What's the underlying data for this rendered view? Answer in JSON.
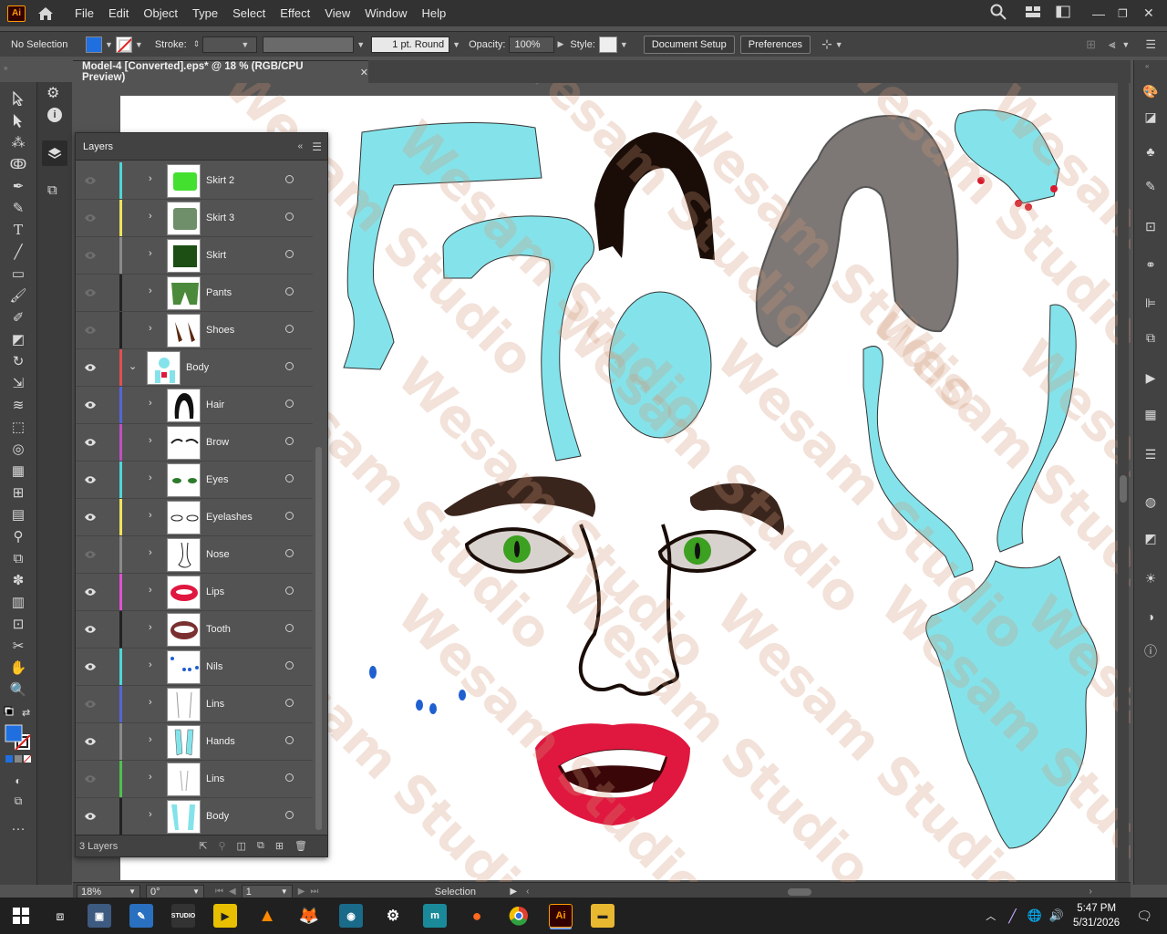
{
  "app": {
    "logo": "Ai"
  },
  "menu": [
    "File",
    "Edit",
    "Object",
    "Type",
    "Select",
    "Effect",
    "View",
    "Window",
    "Help"
  ],
  "control": {
    "selection": "No Selection",
    "stroke_label": "Stroke:",
    "brush_value": "1 pt. Round",
    "opacity_label": "Opacity:",
    "opacity_value": "100%",
    "style_label": "Style:",
    "doc_setup": "Document Setup",
    "preferences": "Preferences",
    "fill_color": "#1f6fe0"
  },
  "document": {
    "tab_title": "Model-4 [Converted].eps* @ 18 % (RGB/CPU Preview)"
  },
  "layers": {
    "title": "Layers",
    "footer_count": "3 Layers",
    "rows": [
      {
        "name": "Skirt 2",
        "visible": false,
        "color": "#4fd6d6",
        "thumb": "skirt2",
        "expanded": false
      },
      {
        "name": "Skirt 3",
        "visible": false,
        "color": "#f0e35b",
        "thumb": "skirt3",
        "expanded": false
      },
      {
        "name": "Skirt",
        "visible": false,
        "color": "#8a8a8a",
        "thumb": "skirt",
        "expanded": false
      },
      {
        "name": "Pants",
        "visible": false,
        "color": "#222222",
        "thumb": "pants",
        "expanded": false
      },
      {
        "name": "Shoes",
        "visible": false,
        "color": "#222222",
        "thumb": "shoes",
        "expanded": false
      },
      {
        "name": "Body",
        "visible": true,
        "color": "#e05050",
        "thumb": "body",
        "expanded": true
      },
      {
        "name": "Hair",
        "visible": true,
        "color": "#5565d8",
        "thumb": "hair",
        "expanded": false
      },
      {
        "name": "Brow",
        "visible": true,
        "color": "#c050c0",
        "thumb": "brow",
        "expanded": false
      },
      {
        "name": "Eyes",
        "visible": true,
        "color": "#4fd6d6",
        "thumb": "eyes",
        "expanded": false
      },
      {
        "name": "Eyelashes",
        "visible": true,
        "color": "#f0e35b",
        "thumb": "eyelashes",
        "expanded": false
      },
      {
        "name": "Nose",
        "visible": false,
        "color": "#8a8a8a",
        "thumb": "nose",
        "expanded": false
      },
      {
        "name": "Lips",
        "visible": true,
        "color": "#e050d0",
        "thumb": "lips",
        "expanded": false
      },
      {
        "name": "Tooth",
        "visible": true,
        "color": "#222222",
        "thumb": "tooth",
        "expanded": false
      },
      {
        "name": "Nils",
        "visible": true,
        "color": "#4fd6d6",
        "thumb": "nils",
        "expanded": false
      },
      {
        "name": "Lins",
        "visible": false,
        "color": "#5565d8",
        "thumb": "lins",
        "expanded": false
      },
      {
        "name": "Hands",
        "visible": true,
        "color": "#8a8a8a",
        "thumb": "hands",
        "expanded": false
      },
      {
        "name": "Lins",
        "visible": false,
        "color": "#50c050",
        "thumb": "lins2",
        "expanded": false
      },
      {
        "name": "Body",
        "visible": true,
        "color": "#222222",
        "thumb": "body2",
        "expanded": false
      }
    ]
  },
  "status": {
    "zoom": "18%",
    "rotation": "0°",
    "artboard": "1",
    "tool": "Selection"
  },
  "watermark": "Wesam Studio",
  "taskbar": {
    "time": "5:47 PM",
    "date": "5/31/2026"
  }
}
